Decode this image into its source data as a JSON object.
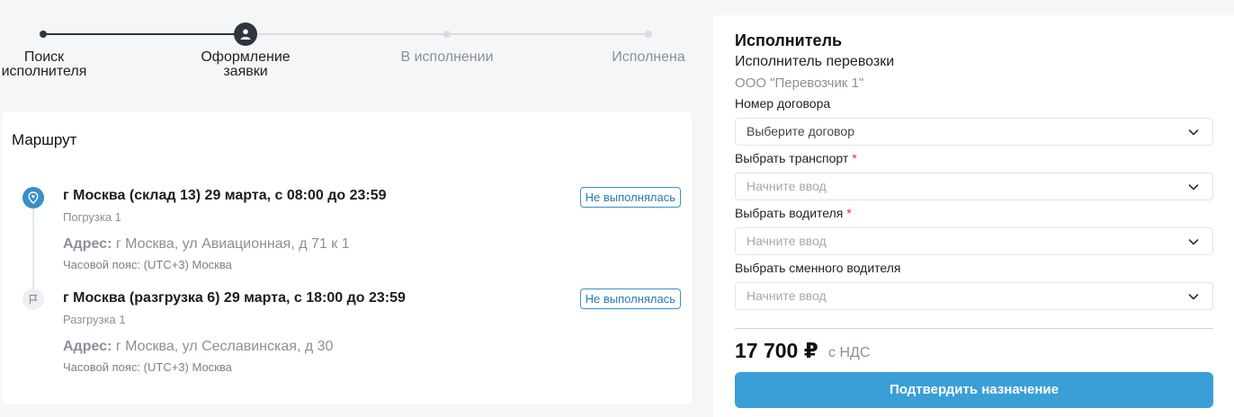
{
  "stepper": {
    "steps": [
      {
        "label": "Поиск\nисполнителя",
        "state": "done"
      },
      {
        "label": "Оформление\nзаявки",
        "state": "current"
      },
      {
        "label": "В исполнении",
        "state": "todo"
      },
      {
        "label": "Исполнена",
        "state": "todo"
      }
    ]
  },
  "route": {
    "title": "Маршрут",
    "points": [
      {
        "title": "г Москва (склад 13) 29 марта, с 08:00 до 23:59",
        "type": "Погрузка 1",
        "address_label": "Адрес:",
        "address": "г Москва, ул Авиационная, д 71 к 1",
        "timezone": "Часовой пояс: (UTC+3) Москва",
        "status": "Не выполнялась",
        "icon": "map-pin-icon"
      },
      {
        "title": "г Москва (разгрузка 6) 29 марта, с 18:00 до 23:59",
        "type": "Разгрузка 1",
        "address_label": "Адрес:",
        "address": "г Москва, ул Сеславинская, д 30",
        "timezone": "Часовой пояс: (UTC+3) Москва",
        "status": "Не выполнялась",
        "icon": "flag-icon"
      }
    ]
  },
  "panel": {
    "title": "Исполнитель",
    "subtitle": "Исполнитель перевозки",
    "company": "ООО \"Перевозчик 1\"",
    "fields": [
      {
        "label": "Номер договора",
        "required": false,
        "value": "Выберите договор",
        "placeholder": ""
      },
      {
        "label": "Выбрать транспорт",
        "required": true,
        "value": "",
        "placeholder": "Начните ввод"
      },
      {
        "label": "Выбрать водителя",
        "required": true,
        "value": "",
        "placeholder": "Начните ввод"
      },
      {
        "label": "Выбрать сменного водителя",
        "required": false,
        "value": "",
        "placeholder": "Начните ввод"
      }
    ],
    "required_mark": "*",
    "price": "17 700 ₽",
    "price_note": "с НДС",
    "confirm_label": "Подтвердить назначение"
  },
  "colors": {
    "accent": "#3a9fd6",
    "stepper_done": "#2d3640",
    "badge": "#3a8fc8",
    "required": "#dd3333"
  }
}
